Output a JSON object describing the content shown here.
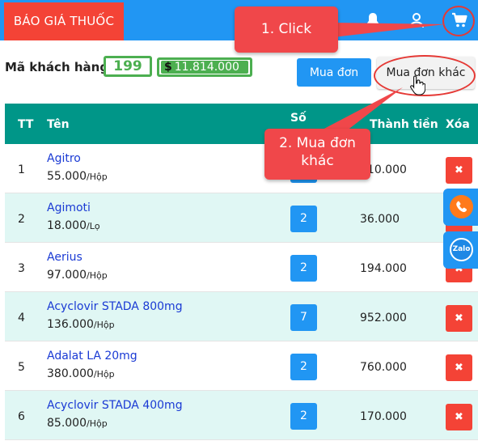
{
  "header": {
    "brand_label": "BÁO GIÁ THUỐC",
    "icons": [
      "bell-icon",
      "user-icon",
      "cart-icon"
    ]
  },
  "customer": {
    "label": "Mã khách hàng",
    "count": "199",
    "currency_symbol": "$",
    "amount": "11.814.000"
  },
  "actions": {
    "buy_label": "Mua đơn",
    "buy_other_label": "Mua đơn khác"
  },
  "table": {
    "headers": {
      "index": "TT",
      "name": "Tên",
      "quantity": "Số",
      "total": "Thành tiền",
      "delete": "Xóa"
    },
    "rows": [
      {
        "index": "1",
        "name": "Agitro",
        "price": "55.000",
        "unit": "/Hộp",
        "quantity": "",
        "total": "110.000"
      },
      {
        "index": "2",
        "name": "Agimoti",
        "price": "18.000",
        "unit": "/Lọ",
        "quantity": "2",
        "total": "36.000"
      },
      {
        "index": "3",
        "name": "Aerius",
        "price": "97.000",
        "unit": "/Hộp",
        "quantity": "2",
        "total": "194.000"
      },
      {
        "index": "4",
        "name": "Acyclovir STADA 800mg",
        "price": "136.000",
        "unit": "/Hộp",
        "quantity": "7",
        "total": "952.000"
      },
      {
        "index": "5",
        "name": "Adalat LA 20mg",
        "price": "380.000",
        "unit": "/Hộp",
        "quantity": "2",
        "total": "760.000"
      },
      {
        "index": "6",
        "name": "Acyclovir STADA 400mg",
        "price": "85.000",
        "unit": "/Hộp",
        "quantity": "2",
        "total": "170.000"
      }
    ],
    "delete_symbol": "✖"
  },
  "floating": {
    "phone_icon": "phone-icon",
    "zalo_label": "Zalo"
  },
  "callouts": {
    "step1": "1. Click",
    "step2_line1": "2. Mua đơn",
    "step2_line2": "khác"
  },
  "colors": {
    "primary": "#2196f3",
    "brand_red": "#f44336",
    "teal_header": "#009688",
    "green_badge": "#4caf50",
    "callout_red": "#f0474a",
    "alt_row": "#e0f7f4",
    "link_blue": "#1a3ad4"
  }
}
